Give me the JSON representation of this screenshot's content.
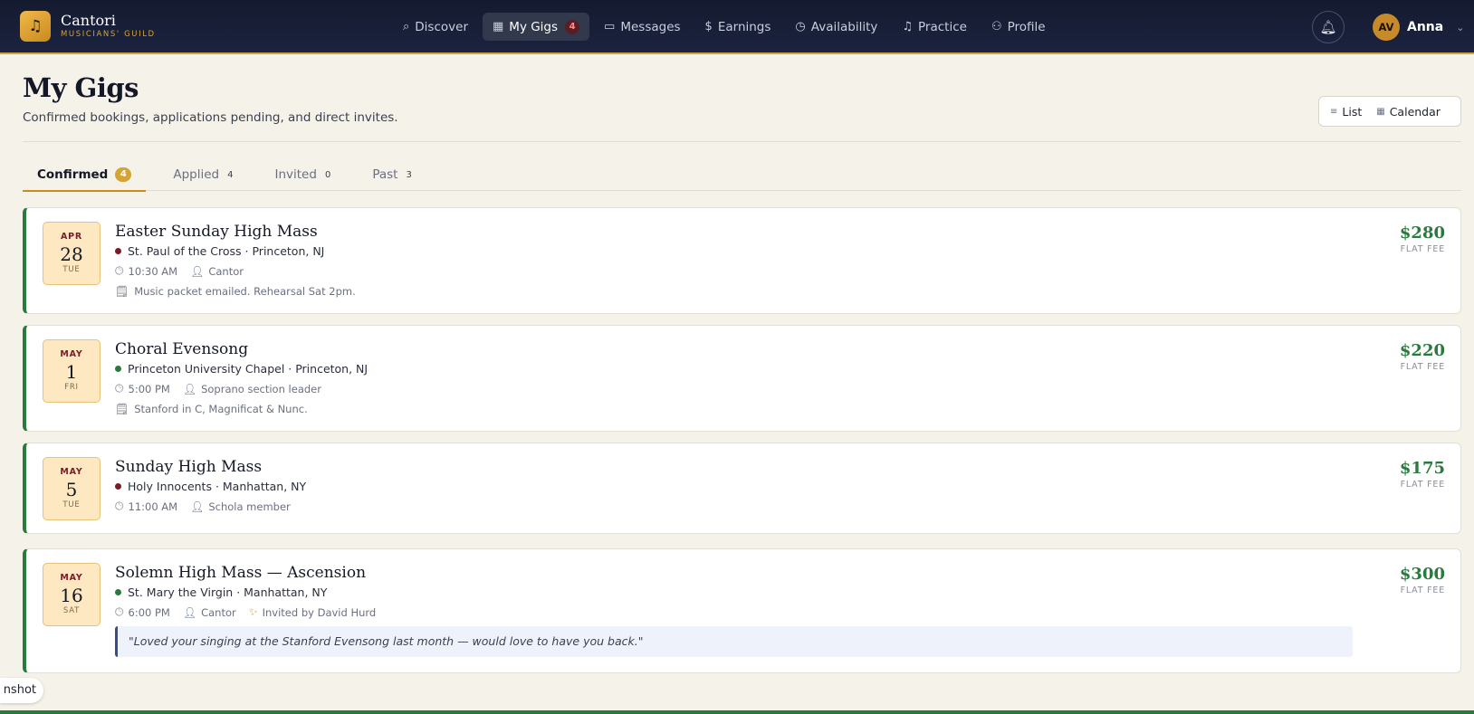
{
  "brand": {
    "name": "Cantori",
    "subtitle": "MUSICIANS' GUILD",
    "logo_icon": "music-note-icon"
  },
  "nav": {
    "items": [
      {
        "label": "Discover",
        "icon": "search-icon"
      },
      {
        "label": "My Gigs",
        "icon": "calendar-icon",
        "badge": "4",
        "active": true
      },
      {
        "label": "Messages",
        "icon": "message-icon"
      },
      {
        "label": "Earnings",
        "icon": "dollar-icon"
      },
      {
        "label": "Availability",
        "icon": "clock-icon"
      },
      {
        "label": "Practice",
        "icon": "music-icon"
      },
      {
        "label": "Profile",
        "icon": "user-icon"
      }
    ]
  },
  "user": {
    "initials": "AV",
    "name": "Anna"
  },
  "header": {
    "title": "My Gigs",
    "subtitle": "Confirmed bookings, applications pending, and direct invites."
  },
  "view_toggle": {
    "list_label": "List",
    "calendar_label": "Calendar"
  },
  "tabs": [
    {
      "label": "Confirmed",
      "count": "4",
      "active": true
    },
    {
      "label": "Applied",
      "count": "4"
    },
    {
      "label": "Invited",
      "count": "0"
    },
    {
      "label": "Past",
      "count": "3"
    }
  ],
  "gigs": [
    {
      "month": "APR",
      "day": "28",
      "weekday": "TUE",
      "title": "Easter Sunday High Mass",
      "venue": "St. Paul of the Cross · Princeton, NJ",
      "venue_dot_color": "#7a1c28",
      "time": "10:30 AM",
      "role": "Cantor",
      "note": "Music packet emailed. Rehearsal Sat 2pm.",
      "fee": "$280",
      "fee_label": "FLAT FEE"
    },
    {
      "month": "MAY",
      "day": "1",
      "weekday": "FRI",
      "title": "Choral Evensong",
      "venue": "Princeton University Chapel · Princeton, NJ",
      "venue_dot_color": "#2a7a3d",
      "time": "5:00 PM",
      "role": "Soprano section leader",
      "note": "Stanford in C, Magnificat & Nunc.",
      "fee": "$220",
      "fee_label": "FLAT FEE"
    },
    {
      "month": "MAY",
      "day": "5",
      "weekday": "TUE",
      "title": "Sunday High Mass",
      "venue": "Holy Innocents · Manhattan, NY",
      "venue_dot_color": "#7a1c28",
      "time": "11:00 AM",
      "role": "Schola member",
      "fee": "$175",
      "fee_label": "FLAT FEE"
    },
    {
      "month": "MAY",
      "day": "16",
      "weekday": "SAT",
      "title": "Solemn High Mass — Ascension",
      "venue": "St. Mary the Virgin · Manhattan, NY",
      "venue_dot_color": "#2a7a3d",
      "time": "6:00 PM",
      "role": "Cantor",
      "invited_by": "Invited by David Hurd",
      "quote": "\"Loved your singing at the Stanford Evensong last month — would love to have you back.\"",
      "fee": "$300",
      "fee_label": "FLAT FEE"
    }
  ],
  "screenshot_tab": {
    "label": "nshot"
  },
  "colors": {
    "accent": "#d4a437",
    "confirmed": "#2a7a3d",
    "nav_bg": "#141a2e",
    "page_bg": "#f5f2ea"
  }
}
